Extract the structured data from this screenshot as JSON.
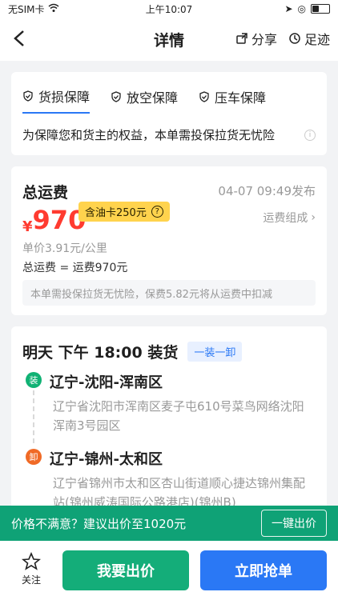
{
  "status": {
    "carrier": "无SIM卡",
    "time": "上午10:07"
  },
  "nav": {
    "title": "详情",
    "share_label": "分享",
    "history_label": "足迹"
  },
  "tabs": [
    {
      "label": "货损保障"
    },
    {
      "label": "放空保障"
    },
    {
      "label": "压车保障"
    }
  ],
  "insurance_text": "为保障您和货主的权益，本单需投保拉货无忧险",
  "freight": {
    "title": "总运费",
    "publish_time": "04-07 09:49发布",
    "price_symbol": "¥",
    "price_value": "970",
    "oil_card": "含油卡250元",
    "composition_link": "运费组成",
    "unit_price": "单价3.91元/公里",
    "total_formula_prefix": "总运费 = ",
    "total_formula_value": "运费970元",
    "notice": "本单需投保拉货无忧险，保费5.82元将从运费中扣减"
  },
  "schedule": {
    "time_text": "明天 下午 18:00 装货",
    "tag": "一装一卸",
    "load": {
      "icon_text": "装",
      "region": "辽宁-沈阳-浑南区",
      "address": "辽宁省沈阳市浑南区麦子屯610号菜鸟网络沈阳浑南3号园区"
    },
    "unload": {
      "icon_text": "卸",
      "region": "辽宁-锦州-太和区",
      "address": "辽宁省锦州市太和区杏山街道顺心捷达锦州集配站(锦州威涛国际公路港店)(锦州B)"
    }
  },
  "suggest": {
    "text": "价格不满意？建议出价至1020元",
    "button": "一键出价"
  },
  "bottom": {
    "fav_label": "关注",
    "bid_label": "我要出价",
    "grab_label": "立即抢单"
  },
  "colors": {
    "green": "#0fa276",
    "blue": "#2a78f5",
    "red": "#ff3b30",
    "yellow": "#ffd34d"
  }
}
